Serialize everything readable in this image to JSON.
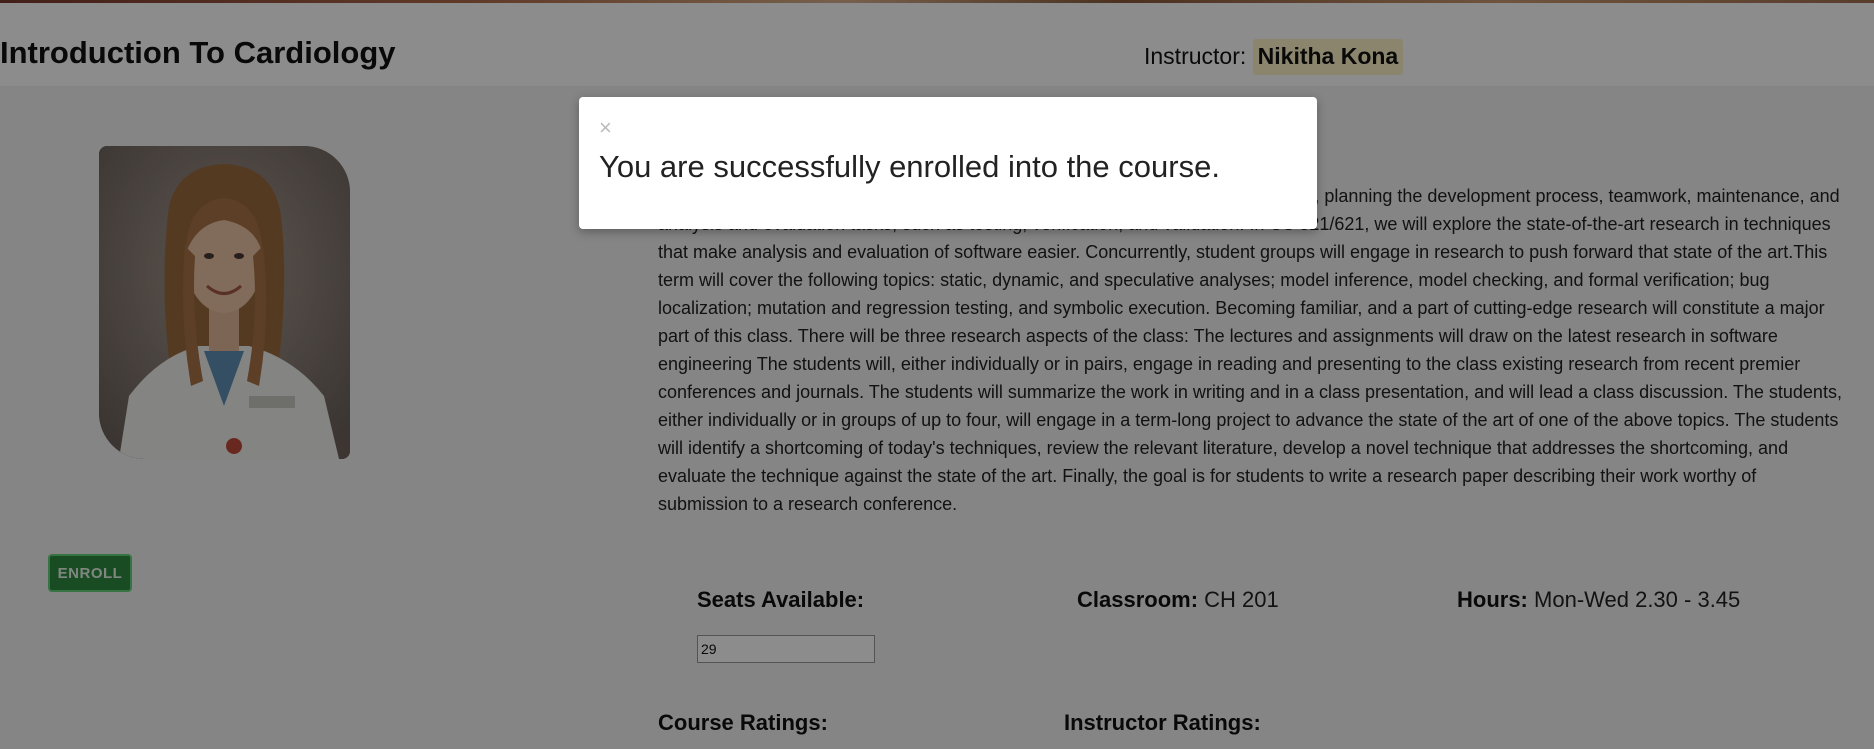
{
  "course": {
    "title": "Introduction To Cardiology"
  },
  "instructor": {
    "label": "Instructor:",
    "name": "Nikitha Kona"
  },
  "photo": {
    "alt": "Instructor photo"
  },
  "enroll": {
    "label": "ENROLL",
    "color": "#2e8a3e"
  },
  "description": {
    "text": "This course covers software engineering topics such as analyzing customer needs, planning the development process, teamwork, maintenance, and analysis and evaluation tasks, such as testing, verification, and validation. In CS 521/621, we will explore the state-of-the-art research in techniques that make analysis and evaluation of software easier. Concurrently, student groups will engage in research to push forward that state of the art.This term will cover the following topics: static, dynamic, and speculative analyses; model inference, model checking, and formal verification; bug localization; mutation and regression testing, and symbolic execution. Becoming familiar, and a part of cutting-edge research will constitute a major part of this class. There will be three research aspects of the class: The lectures and assignments will draw on the latest research in software engineering The students will, either individually or in pairs, engage in reading and presenting to the class existing research from recent premier conferences and journals. The students will summarize the work in writing and in a class presentation, and will lead a class discussion. The students, either individually or in groups of up to four, will engage in a term-long project to advance the state of the art of one of the above topics. The students will identify a shortcoming of today's techniques, review the relevant literature, develop a novel technique that addresses the shortcoming, and evaluate the technique against the state of the art. Finally, the goal is for students to write a research paper describing their work worthy of submission to a research conference."
  },
  "stats": {
    "seats_label": "Seats Available:",
    "seats_value": "29",
    "classroom_label": "Classroom:",
    "classroom_value": "CH 201",
    "hours_label": "Hours:",
    "hours_value": "Mon-Wed 2.30 - 3.45"
  },
  "ratings": {
    "course_label": "Course Ratings:",
    "instructor_label": "Instructor Ratings:"
  },
  "modal": {
    "close_symbol": "×",
    "message": "You are successfully enrolled into the course."
  }
}
